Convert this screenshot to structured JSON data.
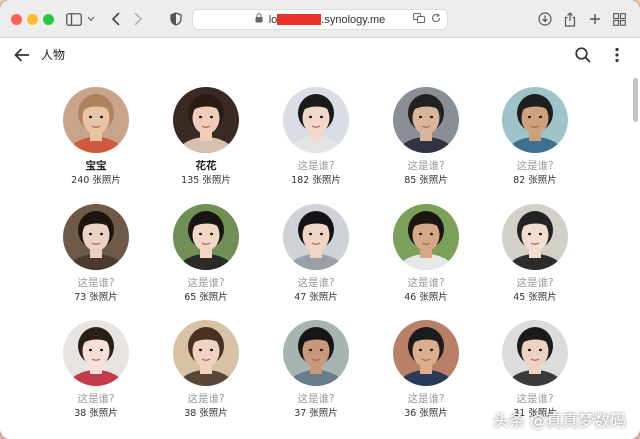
{
  "browser": {
    "address_prefix": "lo",
    "address_suffix": ".synology.me"
  },
  "header": {
    "title": "人物"
  },
  "people": [
    {
      "name": "宝宝",
      "count": "240 张照片",
      "named": true,
      "bg": "#c9a48a",
      "skin": "#e9c4a4",
      "hair": "#b1825e",
      "shirt": "#cf5a3e"
    },
    {
      "name": "花花",
      "count": "135 张照片",
      "named": true,
      "bg": "#3a2a24",
      "skin": "#f0cdb8",
      "hair": "#2a1b15",
      "shirt": "#d8c0b0"
    },
    {
      "name": "这是谁?",
      "count": "182 张照片",
      "named": false,
      "bg": "#d8dde6",
      "skin": "#f2d8cb",
      "hair": "#1a1a1a",
      "shirt": "#e4e4e4"
    },
    {
      "name": "这是谁?",
      "count": "85 张照片",
      "named": false,
      "bg": "#8a8f96",
      "skin": "#d9b59b",
      "hair": "#222222",
      "shirt": "#2f3440"
    },
    {
      "name": "这是谁?",
      "count": "82 张照片",
      "named": false,
      "bg": "#9ec3c8",
      "skin": "#cfa07c",
      "hair": "#1e1e1e",
      "shirt": "#3f6f8f"
    },
    {
      "name": "这是谁?",
      "count": "73 张照片",
      "named": false,
      "bg": "#6e5a48",
      "skin": "#ebd2c2",
      "hair": "#1c1410",
      "shirt": "#4a3a30"
    },
    {
      "name": "这是谁?",
      "count": "65 张照片",
      "named": false,
      "bg": "#6f8f54",
      "skin": "#f2d6c6",
      "hair": "#1a1412",
      "shirt": "#2a2a2a"
    },
    {
      "name": "这是谁?",
      "count": "47 张照片",
      "named": false,
      "bg": "#cfd3d8",
      "skin": "#f0d5c6",
      "hair": "#141414",
      "shirt": "#9aa0a8"
    },
    {
      "name": "这是谁?",
      "count": "46 张照片",
      "named": false,
      "bg": "#7aa05a",
      "skin": "#d6a888",
      "hair": "#1b1612",
      "shirt": "#e8e8e8"
    },
    {
      "name": "这是谁?",
      "count": "45 张照片",
      "named": false,
      "bg": "#d2d0c8",
      "skin": "#f3dcd0",
      "hair": "#222222",
      "shirt": "#2c2c2c"
    },
    {
      "name": "这是谁?",
      "count": "38 张照片",
      "named": false,
      "bg": "#e8e4e2",
      "skin": "#f6e0d6",
      "hair": "#2a1e18",
      "shirt": "#c33a4a"
    },
    {
      "name": "这是谁?",
      "count": "38 张照片",
      "named": false,
      "bg": "#d7c2a6",
      "skin": "#f0d2c0",
      "hair": "#4a3020",
      "shirt": "#5a4636"
    },
    {
      "name": "这是谁?",
      "count": "37 张照片",
      "named": false,
      "bg": "#a7b4b0",
      "skin": "#c8987a",
      "hair": "#151515",
      "shirt": "#6a7d8a"
    },
    {
      "name": "这是谁?",
      "count": "36 张照片",
      "named": false,
      "bg": "#b88068",
      "skin": "#dcae8e",
      "hair": "#1c1c1c",
      "shirt": "#2a3a5a"
    },
    {
      "name": "这是谁?",
      "count": "31 张照片",
      "named": false,
      "bg": "#dcdcdc",
      "skin": "#ecd2c2",
      "hair": "#1a1a1a",
      "shirt": "#3a3a3a"
    }
  ],
  "watermark": "头条 @真真梦数码"
}
